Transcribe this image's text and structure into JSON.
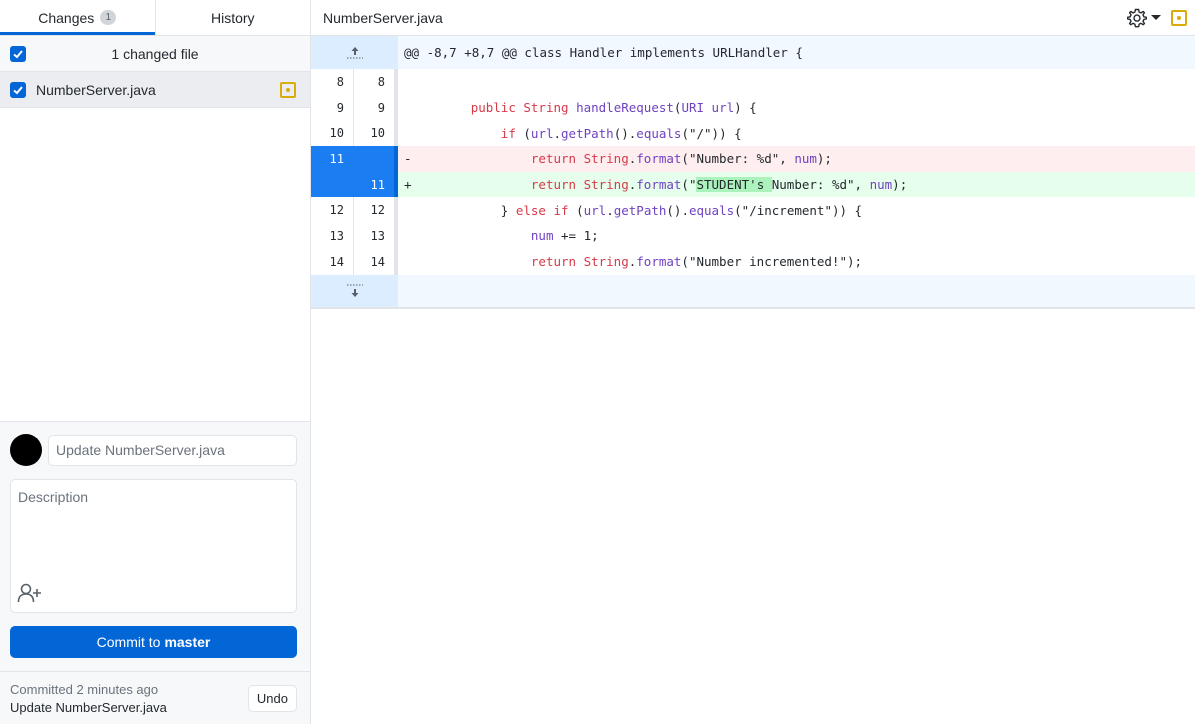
{
  "sidebar": {
    "tabs": [
      {
        "label": "Changes",
        "badge": "1",
        "active": true
      },
      {
        "label": "History",
        "active": false
      }
    ],
    "changes_header": {
      "label": "1 changed file",
      "checked": true
    },
    "files": [
      {
        "name": "NumberServer.java",
        "checked": true,
        "status": "modified",
        "status_color": "#dbab0a"
      }
    ],
    "commit": {
      "summary_placeholder": "Update NumberServer.java",
      "summary_value": "",
      "description_placeholder": "Description",
      "button_prefix": "Commit to",
      "button_branch": "master",
      "button_color": "#0366d6"
    },
    "last_commit": {
      "when": "Committed 2 minutes ago",
      "message": "Update NumberServer.java",
      "undo_label": "Undo"
    }
  },
  "main": {
    "file_title": "NumberServer.java",
    "hunk_header": "@@ -8,7 +8,7 @@ class Handler implements URLHandler {",
    "lines": [
      {
        "type": "context",
        "old": "8",
        "new": "8",
        "prefix": " ",
        "tokens": []
      },
      {
        "type": "context",
        "old": "9",
        "new": "9",
        "prefix": " ",
        "tokens": [
          {
            "t": "    ",
            "c": "txt"
          },
          {
            "t": "public",
            "c": "kw"
          },
          {
            "t": " ",
            "c": "txt"
          },
          {
            "t": "String",
            "c": "kw"
          },
          {
            "t": " ",
            "c": "txt"
          },
          {
            "t": "handleRequest",
            "c": "fn"
          },
          {
            "t": "(",
            "c": "txt"
          },
          {
            "t": "URI",
            "c": "fn"
          },
          {
            "t": " ",
            "c": "txt"
          },
          {
            "t": "url",
            "c": "fn"
          },
          {
            "t": ") {",
            "c": "txt"
          }
        ]
      },
      {
        "type": "context",
        "old": "10",
        "new": "10",
        "prefix": " ",
        "tokens": [
          {
            "t": "        ",
            "c": "txt"
          },
          {
            "t": "if",
            "c": "kw"
          },
          {
            "t": " (",
            "c": "txt"
          },
          {
            "t": "url",
            "c": "fn"
          },
          {
            "t": ".",
            "c": "txt"
          },
          {
            "t": "getPath",
            "c": "fn"
          },
          {
            "t": "().",
            "c": "txt"
          },
          {
            "t": "equals",
            "c": "fn"
          },
          {
            "t": "(\"/\")) {",
            "c": "txt"
          }
        ]
      },
      {
        "type": "del",
        "old": "11",
        "new": "",
        "prefix": "-",
        "tokens": [
          {
            "t": "            ",
            "c": "txt"
          },
          {
            "t": "return",
            "c": "kw"
          },
          {
            "t": " ",
            "c": "txt"
          },
          {
            "t": "String",
            "c": "kw"
          },
          {
            "t": ".",
            "c": "txt"
          },
          {
            "t": "format",
            "c": "fn"
          },
          {
            "t": "(\"Number: %d\", ",
            "c": "txt"
          },
          {
            "t": "num",
            "c": "fn"
          },
          {
            "t": ");",
            "c": "txt"
          }
        ]
      },
      {
        "type": "add",
        "old": "",
        "new": "11",
        "prefix": "+",
        "tokens": [
          {
            "t": "            ",
            "c": "txt"
          },
          {
            "t": "return",
            "c": "kw"
          },
          {
            "t": " ",
            "c": "txt"
          },
          {
            "t": "String",
            "c": "kw"
          },
          {
            "t": ".",
            "c": "txt"
          },
          {
            "t": "format",
            "c": "fn"
          },
          {
            "t": "(\"",
            "c": "txt"
          },
          {
            "t": "STUDENT's ",
            "c": "txt hl-add"
          },
          {
            "t": "Number: %d\", ",
            "c": "txt"
          },
          {
            "t": "num",
            "c": "fn"
          },
          {
            "t": ");",
            "c": "txt"
          }
        ]
      },
      {
        "type": "context",
        "old": "12",
        "new": "12",
        "prefix": " ",
        "tokens": [
          {
            "t": "        } ",
            "c": "txt"
          },
          {
            "t": "else",
            "c": "kw"
          },
          {
            "t": " ",
            "c": "txt"
          },
          {
            "t": "if",
            "c": "kw"
          },
          {
            "t": " (",
            "c": "txt"
          },
          {
            "t": "url",
            "c": "fn"
          },
          {
            "t": ".",
            "c": "txt"
          },
          {
            "t": "getPath",
            "c": "fn"
          },
          {
            "t": "().",
            "c": "txt"
          },
          {
            "t": "equals",
            "c": "fn"
          },
          {
            "t": "(\"/increment\")) {",
            "c": "txt"
          }
        ]
      },
      {
        "type": "context",
        "old": "13",
        "new": "13",
        "prefix": " ",
        "tokens": [
          {
            "t": "            ",
            "c": "txt"
          },
          {
            "t": "num",
            "c": "fn"
          },
          {
            "t": " += 1;",
            "c": "txt"
          }
        ]
      },
      {
        "type": "context",
        "old": "14",
        "new": "14",
        "prefix": " ",
        "tokens": [
          {
            "t": "            ",
            "c": "txt"
          },
          {
            "t": "return",
            "c": "kw"
          },
          {
            "t": " ",
            "c": "txt"
          },
          {
            "t": "String",
            "c": "kw"
          },
          {
            "t": ".",
            "c": "txt"
          },
          {
            "t": "format",
            "c": "fn"
          },
          {
            "t": "(\"Number incremented!\");",
            "c": "txt"
          }
        ]
      }
    ]
  },
  "icons": {
    "expand_up": "expand-up-icon",
    "expand_down": "expand-down-icon",
    "gear": "gear-icon",
    "coauthor": "add-coauthor-icon",
    "modified": "file-modified-icon"
  }
}
